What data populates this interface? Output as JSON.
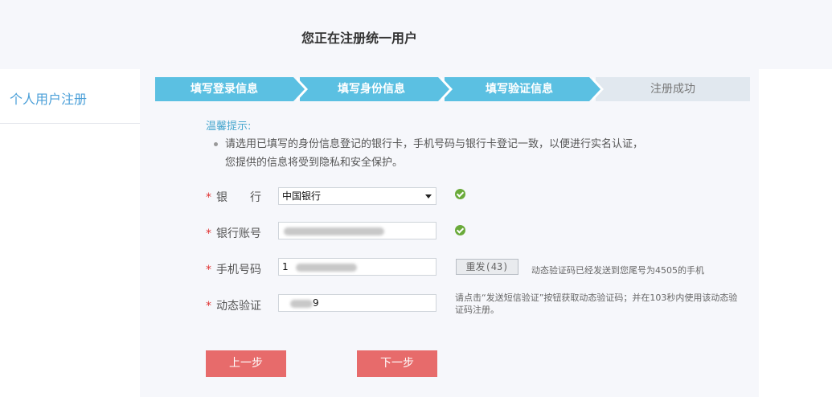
{
  "header": {
    "title": "您正在注册统一用户"
  },
  "sidebar": {
    "items": [
      {
        "label": "个人用户注册"
      }
    ]
  },
  "steps": [
    {
      "label": "填写登录信息",
      "state": "done"
    },
    {
      "label": "填写身份信息",
      "state": "done"
    },
    {
      "label": "填写验证信息",
      "state": "current"
    },
    {
      "label": "注册成功",
      "state": "pending"
    }
  ],
  "tip": {
    "title": "温馨提示:",
    "line1": "请选用已填写的身份信息登记的银行卡，手机号码与银行卡登记一致，以便进行实名认证，",
    "line2": "您提供的信息将受到隐私和安全保护。"
  },
  "form": {
    "required_mark": "*",
    "bank": {
      "label": "银　　行",
      "value": "中国银行",
      "valid": true
    },
    "account": {
      "label": "银行账号",
      "value_visible_prefix": "",
      "valid": true
    },
    "phone": {
      "label": "手机号码",
      "value_visible_prefix": "1"
    },
    "code": {
      "label": "动态验证",
      "value_visible_suffix": "9"
    },
    "resend_label": "重发(43)",
    "sent_note": "动态验证码已经发送到您尾号为4505的手机",
    "hint": "请点击“发送短信验证”按钮获取动态验证码；并在103秒内使用该动态验证码注册。"
  },
  "buttons": {
    "prev": "上一步",
    "next": "下一步"
  },
  "colors": {
    "step_active": "#5bc0e2",
    "button": "#e76b6b",
    "accent_text": "#4a9fd8",
    "required": "#e03030",
    "ok": "#6aaa3a"
  }
}
